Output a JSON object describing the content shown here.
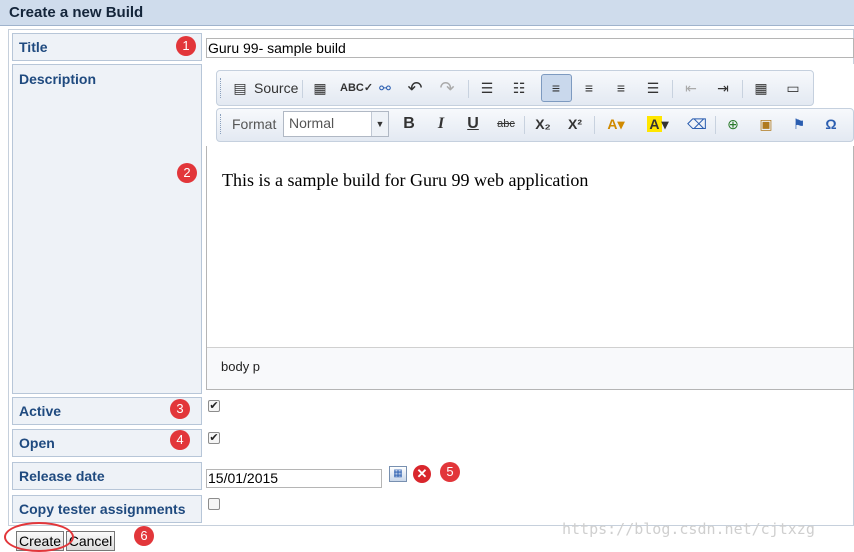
{
  "header": {
    "title": "Create a new Build"
  },
  "form": {
    "title_label": "Title",
    "title_value": "Guru 99- sample build",
    "description_label": "Description",
    "editor": {
      "source_label": "Source",
      "format_label": "Format",
      "format_value": "Normal",
      "content": "This is a sample build for Guru 99 web application",
      "path": "body   p"
    },
    "active_label": "Active",
    "active_checked": true,
    "open_label": "Open",
    "open_checked": true,
    "release_date_label": "Release date",
    "release_date_value": "15/01/2015",
    "copy_tester_label": "Copy tester assignments",
    "copy_tester_checked": false
  },
  "buttons": {
    "create": "Create",
    "cancel": "Cancel"
  },
  "annotations": [
    "1",
    "2",
    "3",
    "4",
    "5",
    "6"
  ],
  "watermark": "https://blog.csdn.net/cjtxzg",
  "colors": {
    "header_bg": "#cfdcec",
    "label_color": "#1f4a7f",
    "badge": "#e2363a"
  }
}
